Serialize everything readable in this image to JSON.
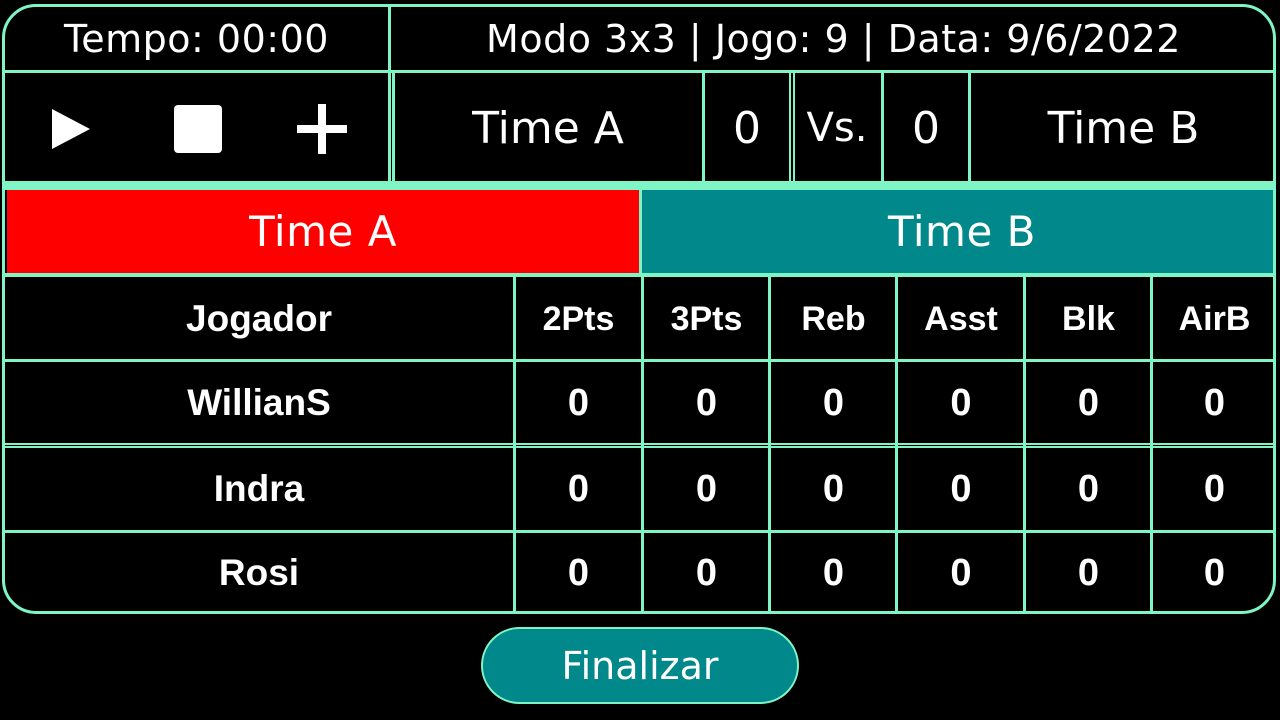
{
  "header": {
    "timer_label": "Tempo: 00:00",
    "game_info": "Modo 3x3 | Jogo: 9 | Data: 9/6/2022"
  },
  "controls": {
    "play_icon": "play-icon",
    "stop_icon": "stop-icon",
    "add_icon": "plus-icon"
  },
  "scoreboard": {
    "team_a_name": "Time A",
    "team_a_score": "0",
    "vs_label": "Vs.",
    "team_b_score": "0",
    "team_b_name": "Time B"
  },
  "teams": {
    "team_a_tab": "Time A",
    "team_b_tab": "Time B",
    "team_a_color": "#ff0000",
    "team_b_color": "#00888a"
  },
  "table": {
    "columns": [
      "Jogador",
      "2Pts",
      "3Pts",
      "Reb",
      "Asst",
      "Blk",
      "AirB"
    ],
    "rows": [
      {
        "player": "WillianS",
        "stats": [
          "0",
          "0",
          "0",
          "0",
          "0",
          "0"
        ]
      },
      {
        "player": "Indra",
        "stats": [
          "0",
          "0",
          "0",
          "0",
          "0",
          "0"
        ]
      },
      {
        "player": "Rosi",
        "stats": [
          "0",
          "0",
          "0",
          "0",
          "0",
          "0"
        ]
      }
    ]
  },
  "footer": {
    "finish_label": "Finalizar"
  },
  "colors": {
    "border": "#7ff5c6",
    "background": "#000000",
    "accent": "#00888a"
  }
}
